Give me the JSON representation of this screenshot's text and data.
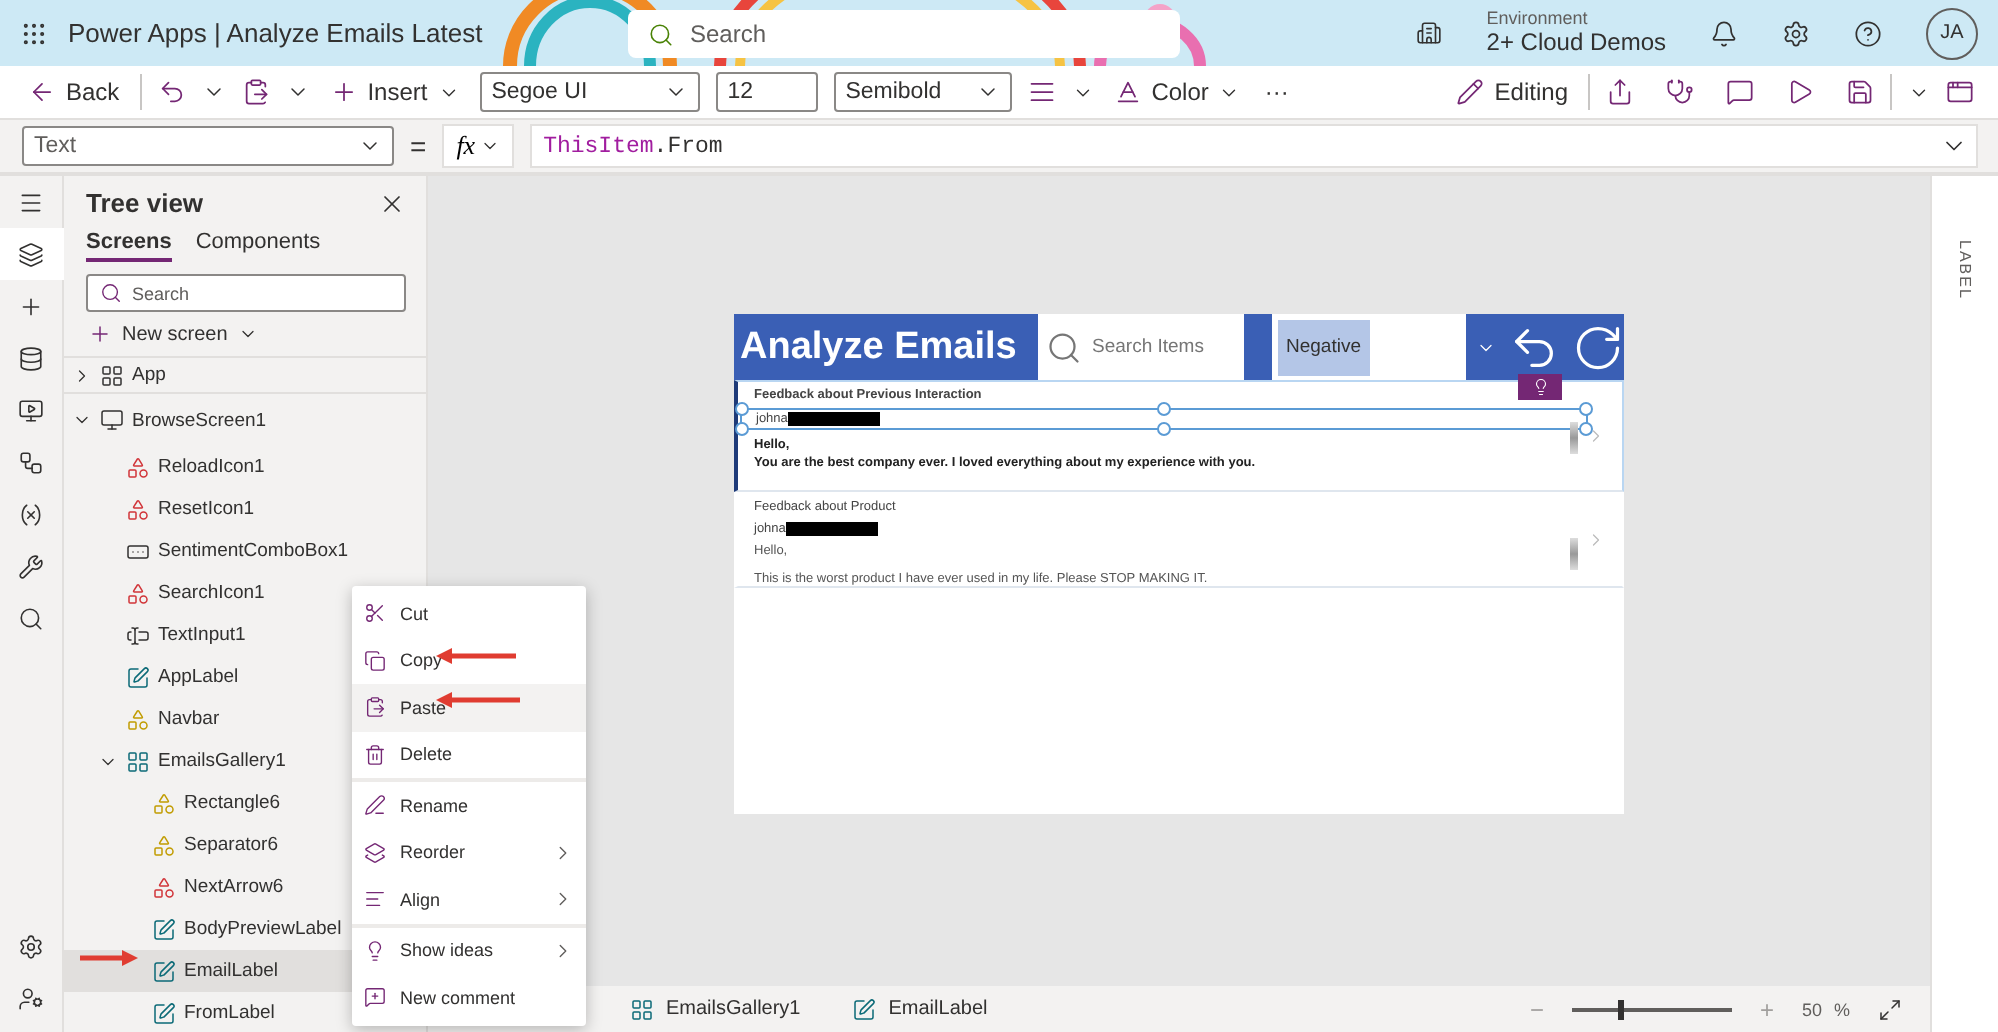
{
  "header": {
    "app_name": "Power Apps",
    "separator": "|",
    "title": "Analyze Emails Latest",
    "search": {
      "placeholder": "Search"
    },
    "environment_label": "Environment",
    "environment": "2+ Cloud Demos",
    "avatar": "JA"
  },
  "toolbar": {
    "back": "Back",
    "insert": "Insert",
    "font": "Segoe UI",
    "size": "12",
    "weight": "Semibold",
    "color_label": "Color",
    "more": "···",
    "editing": "Editing"
  },
  "formula_bar": {
    "property": "Text",
    "equals": "=",
    "fx": "fx",
    "object": "ThisItem",
    "member": ".From"
  },
  "rail": [
    {
      "kind": "menu",
      "selected": false
    },
    {
      "kind": "layers",
      "selected": true
    },
    {
      "kind": "insert",
      "selected": false
    },
    {
      "kind": "data",
      "selected": false
    },
    {
      "kind": "media",
      "selected": false
    },
    {
      "kind": "flows",
      "selected": false
    },
    {
      "kind": "variables",
      "selected": false
    },
    {
      "kind": "tools",
      "selected": false
    },
    {
      "kind": "search",
      "selected": false
    }
  ],
  "rail_bottom": [
    {
      "kind": "settings",
      "selected": false
    },
    {
      "kind": "account",
      "selected": false
    }
  ],
  "tree": {
    "title": "Tree view",
    "tabs": [
      {
        "label": "Screens",
        "selected": true
      },
      {
        "label": "Components",
        "selected": false
      }
    ],
    "search": {
      "placeholder": "Search"
    },
    "new_screen": "New screen",
    "items": [
      {
        "name": "App",
        "kind": "app",
        "expanded": false,
        "selected": false
      },
      {
        "name": "BrowseScreen1",
        "kind": "screen",
        "expanded": true,
        "selected": false,
        "children": [
          {
            "name": "ReloadIcon1",
            "kind": "icon",
            "selected": false
          },
          {
            "name": "ResetIcon1",
            "kind": "icon",
            "selected": false
          },
          {
            "name": "SentimentComboBox1",
            "kind": "combobox",
            "selected": false
          },
          {
            "name": "SearchIcon1",
            "kind": "icon",
            "selected": false
          },
          {
            "name": "TextInput1",
            "kind": "textinput",
            "selected": false
          },
          {
            "name": "AppLabel",
            "kind": "label",
            "selected": false
          },
          {
            "name": "Navbar",
            "kind": "shape",
            "selected": false
          },
          {
            "name": "EmailsGallery1",
            "kind": "gallery",
            "expanded": true,
            "selected": false,
            "children": [
              {
                "name": "Rectangle6",
                "kind": "shape",
                "selected": false
              },
              {
                "name": "Separator6",
                "kind": "shape",
                "selected": false
              },
              {
                "name": "NextArrow6",
                "kind": "icon",
                "selected": false
              },
              {
                "name": "BodyPreviewLabel",
                "kind": "label",
                "selected": false
              },
              {
                "name": "EmailLabel",
                "kind": "label",
                "selected": true
              },
              {
                "name": "FromLabel",
                "kind": "label",
                "selected": false
              }
            ]
          }
        ]
      }
    ]
  },
  "app_preview": {
    "title": "Analyze Emails",
    "search": {
      "placeholder": "Search Items"
    },
    "sentiment": "Negative",
    "items": [
      {
        "subject": "Feedback about Previous Interaction",
        "from": "johna",
        "greeting": "Hello,",
        "body": "You are the best company ever. I loved everything about my experience with you.",
        "selected": true
      },
      {
        "subject": "Feedback about Product",
        "from": "johna",
        "greeting": "Hello,",
        "body": "This is the worst product I have ever used in my life. Please STOP MAKING IT.",
        "selected": false
      }
    ]
  },
  "context_menu": [
    [
      {
        "label": "Cut",
        "kind": "cut",
        "submenu": false,
        "selected": false
      },
      {
        "label": "Copy",
        "kind": "copy",
        "submenu": false,
        "selected": false
      },
      {
        "label": "Paste",
        "kind": "paste",
        "submenu": false,
        "selected": true
      },
      {
        "label": "Delete",
        "kind": "delete",
        "submenu": false,
        "selected": false
      }
    ],
    [
      {
        "label": "Rename",
        "kind": "rename",
        "submenu": false,
        "selected": false
      },
      {
        "label": "Reorder",
        "kind": "reorder",
        "submenu": true,
        "selected": false
      },
      {
        "label": "Align",
        "kind": "align",
        "submenu": true,
        "selected": false
      }
    ],
    [
      {
        "label": "Show ideas",
        "kind": "ideas",
        "submenu": true,
        "selected": false
      },
      {
        "label": "New comment",
        "kind": "comment",
        "submenu": false,
        "selected": false
      }
    ]
  ],
  "breadcrumbs": [
    {
      "label": "EmailsGallery1",
      "kind": "gallery"
    },
    {
      "label": "EmailLabel",
      "kind": "label"
    }
  ],
  "zoom": {
    "minus": "−",
    "plus": "+",
    "level": 0.29,
    "reading": "50",
    "unit": "%"
  },
  "properties_panel": {
    "label": "LABEL"
  }
}
